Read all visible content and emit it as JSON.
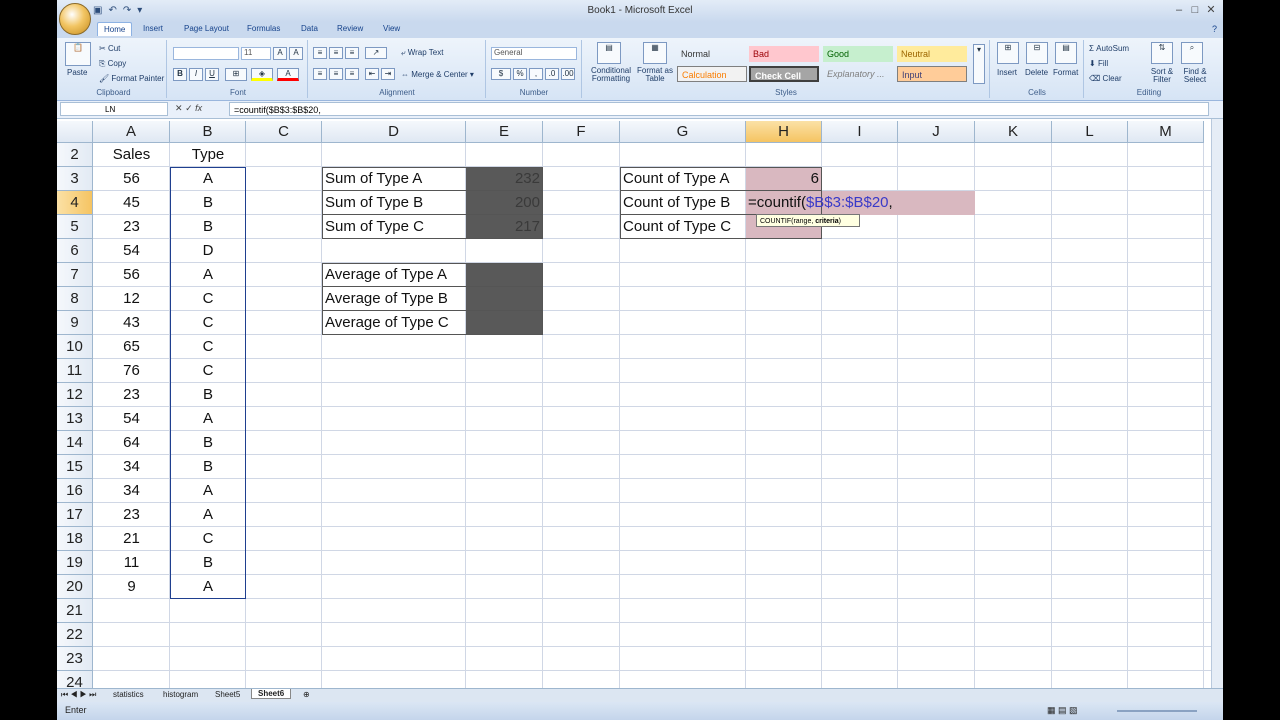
{
  "app": {
    "title": "Book1 - Microsoft Excel"
  },
  "tabs": [
    "Home",
    "Insert",
    "Page Layout",
    "Formulas",
    "Data",
    "Review",
    "View"
  ],
  "ribbon": {
    "clipboard": {
      "paste": "Paste",
      "cut": "Cut",
      "copy": "Copy",
      "format_painter": "Format Painter",
      "label": "Clipboard"
    },
    "font": {
      "size": "11",
      "bold": "B",
      "italic": "I",
      "underline": "U",
      "label": "Font"
    },
    "alignment": {
      "wrap": "Wrap Text",
      "merge": "Merge & Center",
      "label": "Alignment"
    },
    "number": {
      "format": "General",
      "currency": "$",
      "percent": "%",
      "comma": ",",
      "label": "Number"
    },
    "styles": {
      "conditional": "Conditional Formatting",
      "format_table": "Format as Table",
      "label": "Styles",
      "cells": [
        [
          "Normal",
          "Bad",
          "Good",
          "Neutral"
        ],
        [
          "Calculation",
          "Check Cell",
          "Explanatory ...",
          "Input"
        ]
      ]
    },
    "cells": {
      "insert": "Insert",
      "delete": "Delete",
      "format": "Format",
      "label": "Cells"
    },
    "editing": {
      "autosum": "AutoSum",
      "fill": "Fill",
      "clear": "Clear",
      "sort": "Sort & Filter",
      "find": "Find & Select",
      "label": "Editing"
    }
  },
  "formula_bar": {
    "name_box": "LN",
    "cancel": "✕",
    "enter": "✓",
    "fx": "fx",
    "formula": "=countif($B$3:$B$20,"
  },
  "columns": [
    "A",
    "B",
    "C",
    "D",
    "E",
    "F",
    "G",
    "H",
    "I",
    "J",
    "K",
    "L",
    "M"
  ],
  "rows": [
    "2",
    "3",
    "4",
    "5",
    "6",
    "7",
    "8",
    "9",
    "10",
    "11",
    "12",
    "13",
    "14",
    "15",
    "16",
    "17",
    "18",
    "19",
    "20",
    "21",
    "22",
    "23",
    "24"
  ],
  "sheet": {
    "header_sales": "Sales",
    "header_type": "Type",
    "sales": [
      "56",
      "45",
      "23",
      "54",
      "56",
      "12",
      "43",
      "65",
      "76",
      "23",
      "54",
      "64",
      "34",
      "34",
      "23",
      "21",
      "11",
      "9"
    ],
    "types": [
      "A",
      "B",
      "B",
      "D",
      "A",
      "C",
      "C",
      "C",
      "C",
      "B",
      "A",
      "B",
      "B",
      "A",
      "A",
      "C",
      "B",
      "A"
    ],
    "sum_labels": [
      "Sum of Type A",
      "Sum of Type B",
      "Sum of Type C"
    ],
    "sum_values": [
      "232",
      "200",
      "217"
    ],
    "avg_labels": [
      "Average of Type A",
      "Average of Type B",
      "Average of Type C"
    ],
    "count_labels": [
      "Count of Type A",
      "Count of Type B",
      "Count of Type C"
    ],
    "count_a": "6",
    "edit_prefix": "=countif(",
    "edit_range": "$B$3:$B$20",
    "edit_suffix": ",",
    "tooltip_fn": "COUNTIF(range, ",
    "tooltip_arg": "criteria",
    "tooltip_end": ")"
  },
  "sheet_tabs": [
    "statistics",
    "histogram",
    "Sheet5",
    "Sheet6"
  ],
  "status": {
    "mode": "Enter"
  }
}
